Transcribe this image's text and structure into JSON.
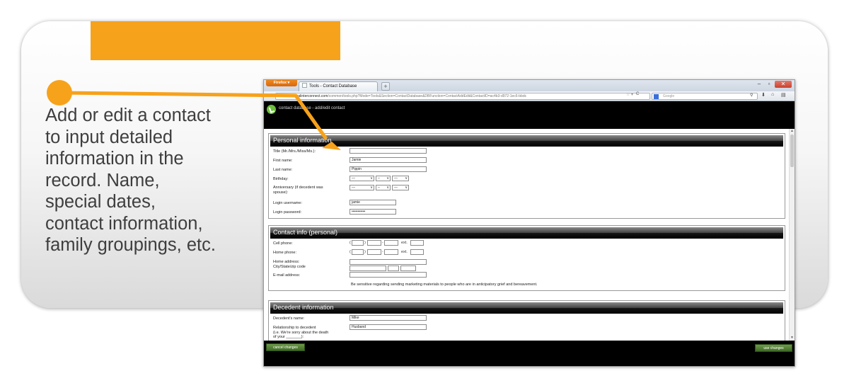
{
  "callout": {
    "text": "Add or edit a contact\nto input detailed\ninformation in the\nrecord.  Name,\nspecial dates,\ncontact information,\nfamily groupings, etc."
  },
  "colors": {
    "accent": "#f7a21b",
    "button_green": "#4f7f33"
  },
  "browser": {
    "app_button": "Firefox ▾",
    "tab_title": "Tools - Contact Database",
    "new_tab": "+",
    "controls": {
      "minimize": "–",
      "maximize": "▫",
      "close": "✕"
    },
    "url_prefix": "www.",
    "url_domain": "virtualinterconnect.com",
    "url_path": "/common/tools.php?Mode=Tools&Section=ContactDatabase&DBFunction=ContactAddEdit&ContactID=ac4b3-d972-1ec6-bbdc",
    "search_placeholder": "Google"
  },
  "app": {
    "breadcrumb": "contact database - add/edit contact"
  },
  "personal": {
    "heading": "Personal information",
    "title_label": "Title (Mr./Mrs./Miss/Ms.):",
    "title_value": "",
    "first_name_label": "First name:",
    "first_name_value": "Jamie",
    "last_name_label": "Last name:",
    "last_name_value": "Pippin",
    "birthday_label": "Birthday:",
    "birthday_month": "—",
    "birthday_day": "–",
    "birthday_year": "—",
    "anniversary_label": "Anniversary (if decedent was\nspouse):",
    "anniversary_month": "—",
    "anniversary_day": "–",
    "anniversary_year": "—",
    "login_username_label": "Login username:",
    "login_username_value": "jamie",
    "login_password_label": "Login password:",
    "login_password_value": "•••••••••••"
  },
  "contact": {
    "heading": "Contact info (personal)",
    "cell_label": "Cell phone:",
    "home_phone_label": "Home phone:",
    "paren_open": "(",
    "paren_close": ")",
    "dash": "-",
    "ext_label": "ext.",
    "address_label": "Home address:\nCity/State/zip code",
    "email_label": "E-mail address:",
    "note": "Be sensitive regarding sending marketing materials to people who are in anticipatory grief and bereavement."
  },
  "decedent": {
    "heading": "Decedent information",
    "name_label": "Decedent's name:",
    "name_value": "Mike",
    "relationship_label": "Relationship to decedent\n(i.e. We're sorry about the death\nof your _______):",
    "relationship_value": "Husband"
  },
  "footer": {
    "cancel_label": "cancel changes",
    "use_label": "use changes"
  }
}
